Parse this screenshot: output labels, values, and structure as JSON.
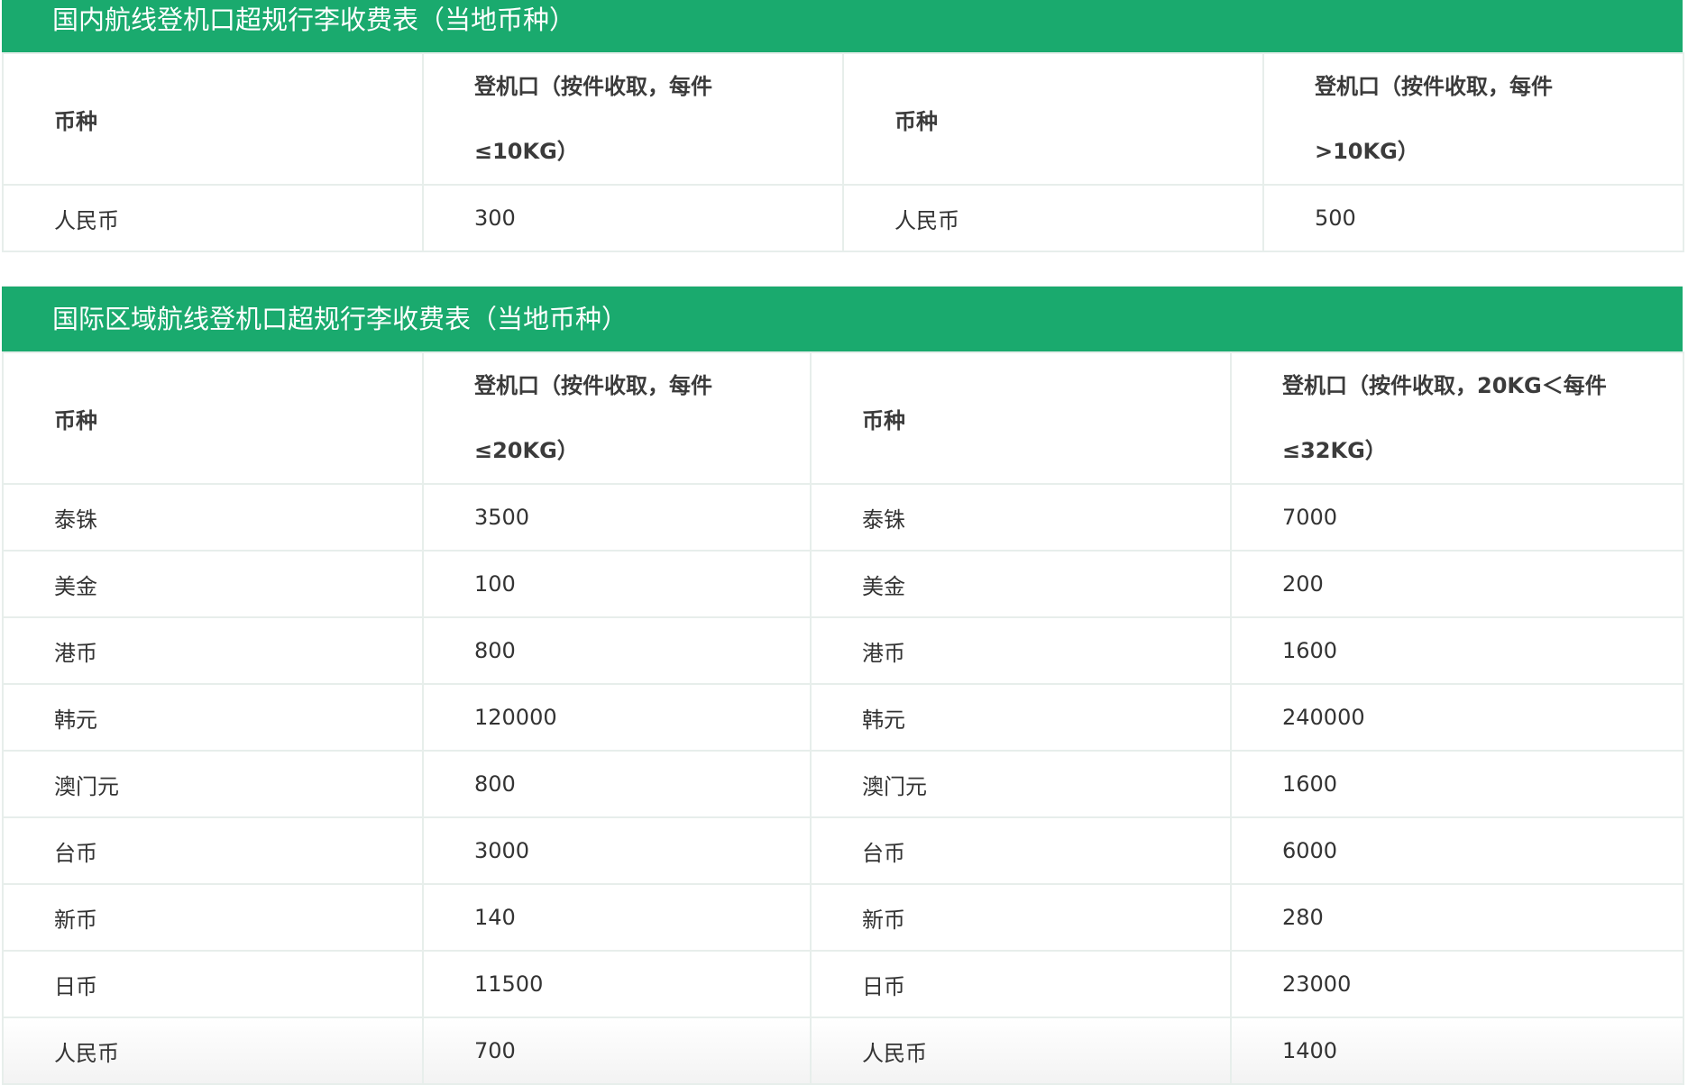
{
  "domestic": {
    "title": "国内航线登机口超规行李收费表（当地币种）",
    "header": {
      "currency_label": "币种",
      "fee_label_line1": "登机口（按件收取，每件",
      "fee_label_line2": "≤10KG）",
      "currency_label_2": "币种",
      "fee_label_2_line1": "登机口（按件收取，每件",
      "fee_label_2_line2": ">10KG）"
    },
    "rows": [
      {
        "currency": "人民币",
        "fee": "300",
        "currency_2": "人民币",
        "fee_2": "500"
      }
    ]
  },
  "international": {
    "title": "国际区域航线登机口超规行李收费表（当地币种）",
    "header": {
      "currency_label": "币种",
      "fee_label_line1": "登机口（按件收取，每件",
      "fee_label_line2": "≤20KG）",
      "currency_label_2": "币种",
      "fee_label_2_line1": "登机口（按件收取，20KG＜每件",
      "fee_label_2_line2": "≤32KG）"
    },
    "rows": [
      {
        "currency": "泰铢",
        "fee": "3500",
        "currency_2": "泰铢",
        "fee_2": "7000"
      },
      {
        "currency": "美金",
        "fee": "100",
        "currency_2": "美金",
        "fee_2": "200"
      },
      {
        "currency": "港币",
        "fee": "800",
        "currency_2": "港币",
        "fee_2": "1600"
      },
      {
        "currency": "韩元",
        "fee": "120000",
        "currency_2": "韩元",
        "fee_2": "240000"
      },
      {
        "currency": "澳门元",
        "fee": "800",
        "currency_2": "澳门元",
        "fee_2": "1600"
      },
      {
        "currency": "台币",
        "fee": "3000",
        "currency_2": "台币",
        "fee_2": "6000"
      },
      {
        "currency": "新币",
        "fee": "140",
        "currency_2": "新币",
        "fee_2": "280"
      },
      {
        "currency": "日币",
        "fee": "11500",
        "currency_2": "日币",
        "fee_2": "23000"
      },
      {
        "currency": "人民币",
        "fee": "700",
        "currency_2": "人民币",
        "fee_2": "1400"
      }
    ]
  }
}
